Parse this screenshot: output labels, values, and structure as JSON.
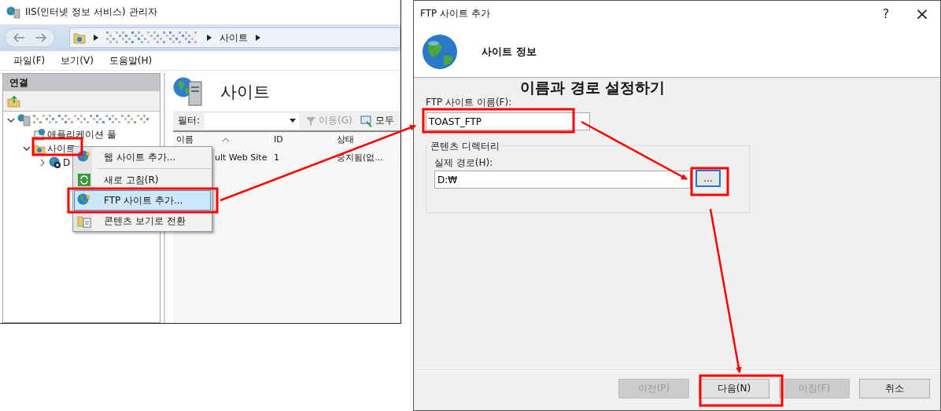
{
  "iis_window": {
    "title": "IIS(인터넷 정보 서비스) 관리자",
    "breadcrumb": [
      {
        "kind": "blurred"
      },
      {
        "kind": "text",
        "label": "사이트"
      }
    ],
    "menu": [
      "파일(F)",
      "보기(V)",
      "도움말(H)"
    ],
    "connections": {
      "title": "연결",
      "tree": [
        {
          "kind": "server",
          "expanded": true,
          "children": [
            {
              "kind": "pool",
              "label": "애플리케이션 풀"
            },
            {
              "kind": "sites",
              "label": "사이트",
              "expanded": true,
              "children": [
                {
                  "kind": "site",
                  "label": "D",
                  "expanded": false
                }
              ]
            }
          ]
        }
      ]
    },
    "content": {
      "title": "사이트",
      "filter": {
        "label": "필터:"
      },
      "actions": [
        {
          "kind": "go",
          "label": "이동(G)",
          "disabled": true
        },
        {
          "kind": "all",
          "label": "모두",
          "disabled": false
        }
      ],
      "columns": [
        "이름",
        "ID",
        "상태"
      ],
      "rows": [
        [
          "ult Web Site",
          "1",
          "중지됨(없..."
        ]
      ]
    },
    "context_menu": [
      {
        "kind": "add-web",
        "label": "웹 사이트 추가...",
        "selected": false
      },
      {
        "kind": "refresh",
        "label": "새로 고침(R)",
        "selected": false
      },
      {
        "kind": "add-ftp",
        "label": "FTP 사이트 추가...",
        "selected": true
      },
      {
        "kind": "content-view",
        "label": "콘텐츠 보기로 전환",
        "selected": false
      }
    ]
  },
  "ftp_dialog": {
    "title": "FTP 사이트 추가",
    "help": "?",
    "close": "×",
    "header": "사이트 정보",
    "annotation": "이름과 경로 설정하기",
    "name_field": {
      "label": "FTP 사이트 이름(F):",
      "value": "TOAST_FTP"
    },
    "content_directory": {
      "title": "콘텐츠 디렉터리",
      "path_label": "실제 경로(H):",
      "path_value": "D:₩",
      "browse": "..."
    },
    "buttons": [
      {
        "label": "이전(P)",
        "disabled": true
      },
      {
        "label": "다음(N)",
        "disabled": false
      },
      {
        "label": "마침(F)",
        "disabled": true
      },
      {
        "label": "취소",
        "disabled": false
      }
    ]
  }
}
